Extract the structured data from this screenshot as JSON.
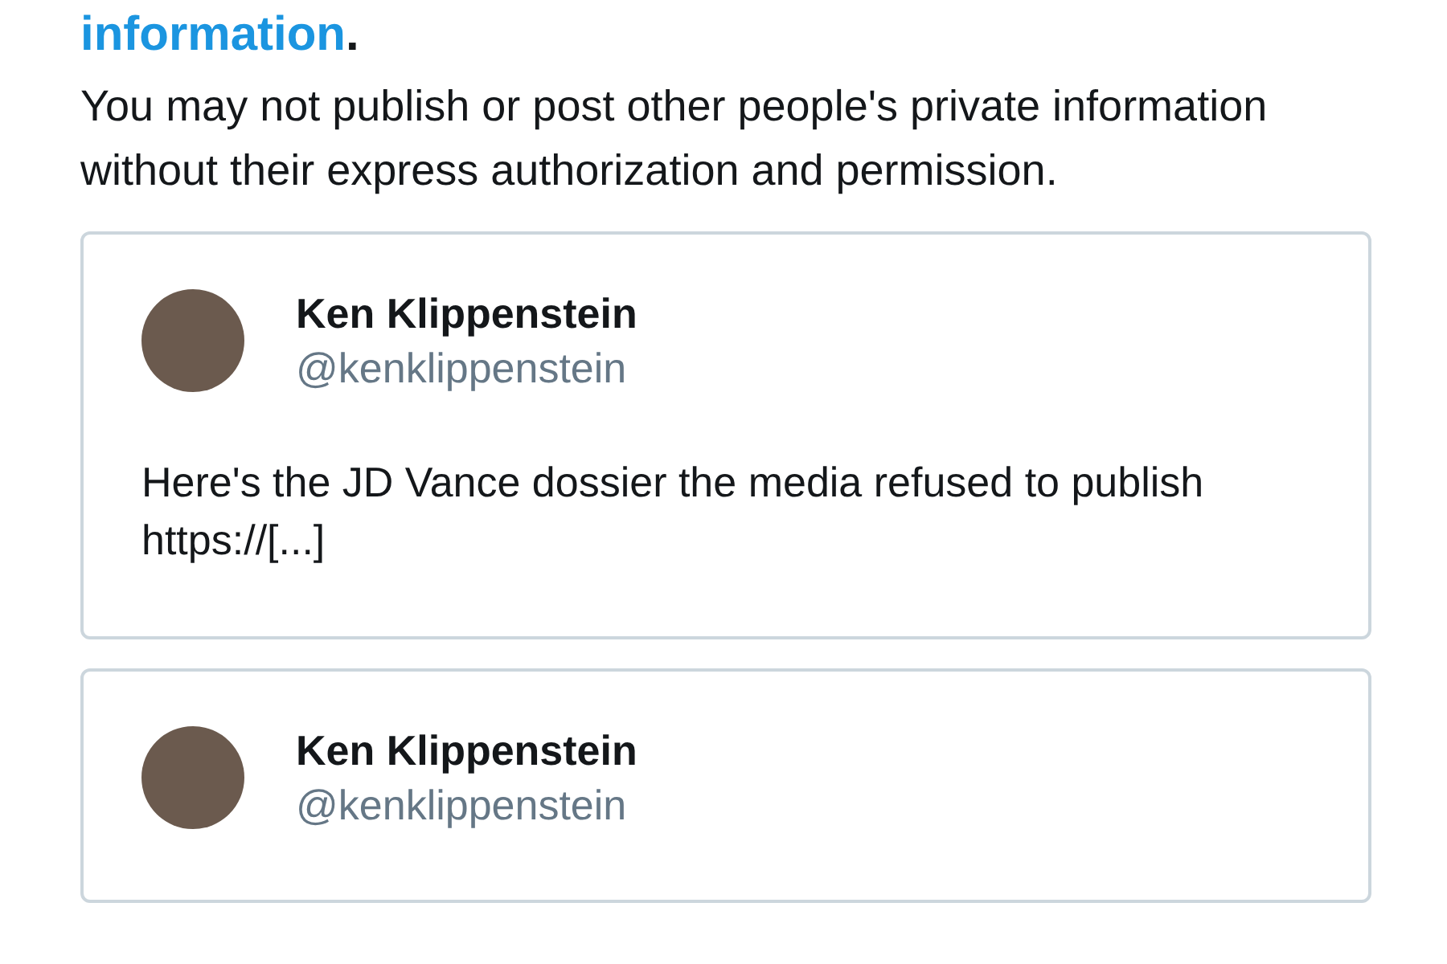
{
  "heading": {
    "link": "information",
    "tail": "."
  },
  "paragraph": "You may not publish or post other people's private information without their express authorization and permission.",
  "tweets": [
    {
      "name": "Ken Klippenstein",
      "handle": "@kenklippenstein",
      "text": "Here's the JD Vance dossier the media refused to publish https://[...]"
    },
    {
      "name": "Ken Klippenstein",
      "handle": "@kenklippenstein"
    }
  ]
}
